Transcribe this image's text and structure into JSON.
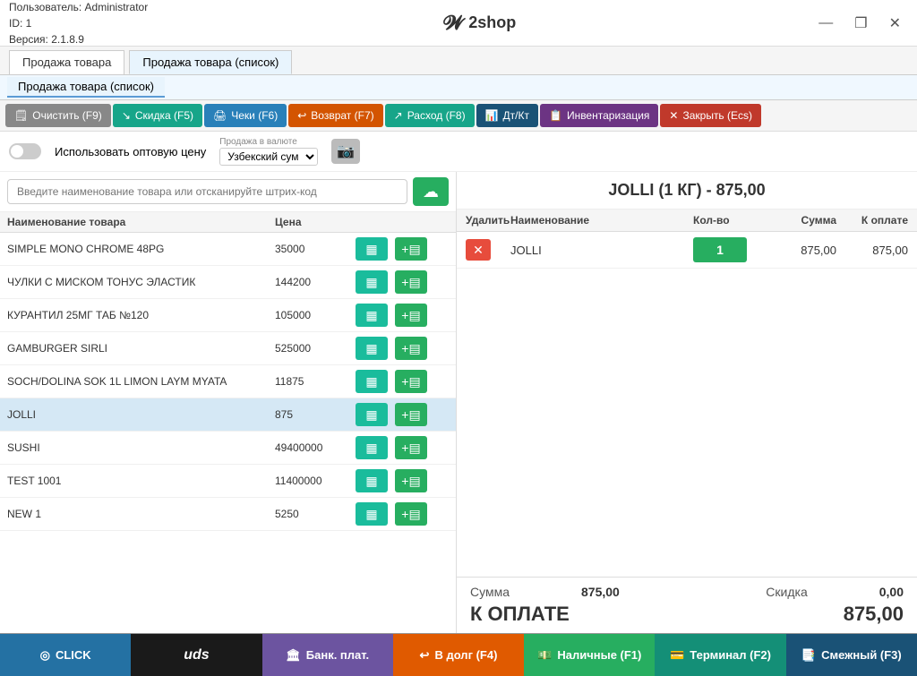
{
  "titlebar": {
    "user_label": "Пользователь: Administrator",
    "id_label": "ID: 1",
    "version_label": "Версия: 2.1.8.9",
    "app_name": "2shop",
    "minimize": "—",
    "restore": "❐",
    "close": "✕"
  },
  "nav": {
    "tab1": "Продажа товара",
    "tab2": "Продажа товара (список)"
  },
  "active_tab": "Продажа товара (список)",
  "toolbar": {
    "clear": "Очистить (F9)",
    "discount": "Скидка (F5)",
    "checks": "Чеки (F6)",
    "return": "Возврат (F7)",
    "expense": "Расход (F8)",
    "dt_kt": "Дт/Кт",
    "inventory": "Инвентаризация",
    "close": "Закрыть (Ecs)"
  },
  "options": {
    "wholesale_label": "Использовать оптовую цену",
    "currency_label": "Продажа в валюте",
    "currency_value": "Узбекский сум"
  },
  "search": {
    "placeholder": "Введите наименование товара или отсканируйте штрих-код"
  },
  "products_header": {
    "name": "Наименование товара",
    "price": "Цена"
  },
  "products": [
    {
      "name": "SIMPLE MONO CHROME 48PG",
      "price": "35000",
      "selected": false
    },
    {
      "name": "ЧУЛКИ С МИСКОМ ТОНУС ЭЛАСТИК",
      "price": "144200",
      "selected": false
    },
    {
      "name": "КУРАНТИЛ 25МГ ТАБ №120",
      "price": "105000",
      "selected": false
    },
    {
      "name": "GAMBURGER SIRLI",
      "price": "525000",
      "selected": false
    },
    {
      "name": "SOCH/DOLINA SOK 1L LIMON LAYM MYATA",
      "price": "11875",
      "selected": false
    },
    {
      "name": "JOLLI",
      "price": "875",
      "selected": true
    },
    {
      "name": "SUSHI",
      "price": "49400000",
      "selected": false
    },
    {
      "name": "TEST 1001",
      "price": "11400000",
      "selected": false
    },
    {
      "name": "NEW 1",
      "price": "5250",
      "selected": false
    }
  ],
  "cart": {
    "title": "JOLLI (1 КГ) - 875,00",
    "header": {
      "delete": "Удалить",
      "name": "Наименование",
      "qty": "Кол-во",
      "sum": "Сумма",
      "topay": "К оплате"
    },
    "items": [
      {
        "name": "JOLLI",
        "qty": "1",
        "sum": "875,00",
        "topay": "875,00"
      }
    ]
  },
  "totals": {
    "sum_label": "Сумма",
    "sum_value": "875,00",
    "discount_label": "Скидка",
    "discount_value": "0,00",
    "topay_label": "К ОПЛАТЕ",
    "topay_value": "875,00"
  },
  "bottom_buttons": {
    "click": "CLICK",
    "uds": "uds",
    "bank": "Банк. плат.",
    "debt": "В долг (F4)",
    "cash": "Наличные (F1)",
    "terminal": "Терминал (F2)",
    "mixed": "Смежный (F3)"
  }
}
